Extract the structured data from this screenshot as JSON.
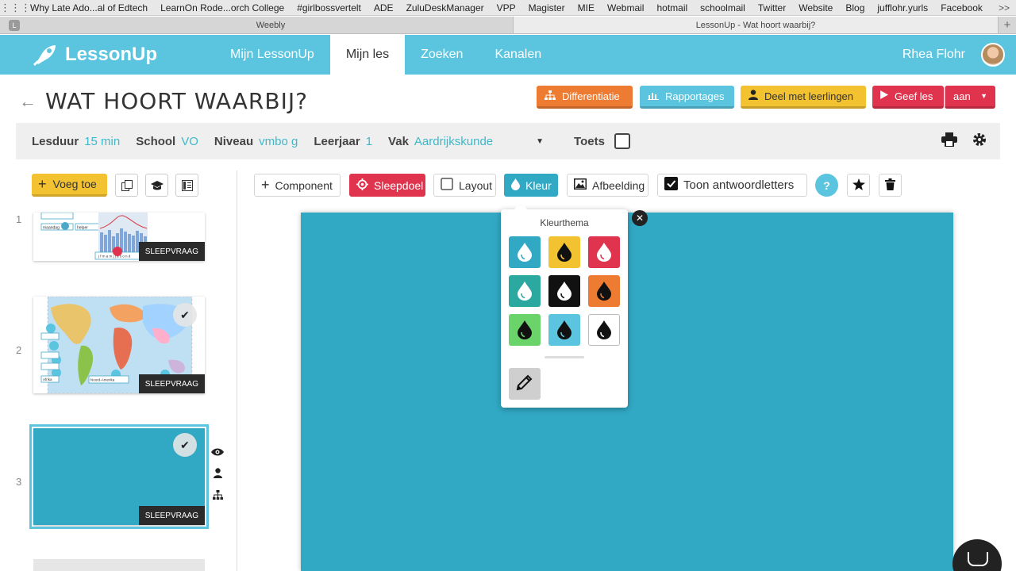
{
  "browser": {
    "bookmarks": [
      "Why Late Ado...al of Edtech",
      "LearnOn Rode...orch College",
      "#girlbossvertelt",
      "ADE",
      "ZuluDeskManager",
      "VPP",
      "Magister",
      "MIE",
      "Webmail",
      "hotmail",
      "schoolmail",
      "Twitter",
      "Website",
      "Blog",
      "jufflohr.yurls",
      "Facebook"
    ],
    "bookmarks_more": ">>",
    "tab_lead": "L",
    "tabs": [
      {
        "label": "Weebly"
      },
      {
        "label": "LessonUp - Wat hoort waarbij?"
      }
    ],
    "new_tab": "+"
  },
  "header": {
    "logo": "LessonUp",
    "nav": [
      "Mijn LessonUp",
      "Mijn les",
      "Zoeken",
      "Kanalen"
    ],
    "active_nav": "Mijn les",
    "user_name": "Rhea Flohr",
    "brand_color": "#5bc4de"
  },
  "title": {
    "back_icon": "←",
    "text": "WAT HOORT WAARBIJ?",
    "buttons": {
      "differentiatie": "Differentiatie",
      "rapportages": "Rapportages",
      "deel": "Deel met leerlingen",
      "geef_les": "Geef les",
      "aan": "aan",
      "aan_caret": "▼"
    }
  },
  "meta": {
    "lesduur_label": "Lesduur",
    "lesduur_value": "15 min",
    "school_label": "School",
    "school_value": "VO",
    "niveau_label": "Niveau",
    "niveau_value": "vmbo g",
    "leerjaar_label": "Leerjaar",
    "leerjaar_value": "1",
    "vak_label": "Vak",
    "vak_value": "Aardrijkskunde",
    "dropdown_caret": "▼",
    "toets_label": "Toets",
    "toets_checked": false
  },
  "sidebar": {
    "add_button": "Voeg toe",
    "add_plus": "+",
    "slides": [
      {
        "number": "1",
        "tag": "SLEEPVRAAG"
      },
      {
        "number": "2",
        "tag": "SLEEPVRAAG"
      },
      {
        "number": "3",
        "tag": "SLEEPVRAAG"
      }
    ],
    "slide1_labels": {
      "a": "maandag",
      "b": "helper",
      "months": "j f m a m j j a s o n d"
    },
    "slide2_labels": {
      "a": "Noord-Amerika",
      "b": "Afrika"
    }
  },
  "editor": {
    "toolbar": {
      "component": "Component",
      "sleepdoel": "Sleepdoel",
      "layout": "Layout",
      "kleur": "Kleur",
      "afbeelding": "Afbeelding",
      "toon": "Toon antwoordletters",
      "help": "?"
    },
    "canvas_color": "#31a9c5"
  },
  "color_popover": {
    "title": "Kleurthema",
    "close": "✕",
    "swatches": [
      {
        "bg": "#31a9c5",
        "drop": "#ffffff"
      },
      {
        "bg": "#f3c231",
        "drop": "#111111"
      },
      {
        "bg": "#e0344e",
        "drop": "#ffffff"
      },
      {
        "bg": "#2ba9a1",
        "drop": "#ffffff"
      },
      {
        "bg": "#111111",
        "drop": "#ffffff"
      },
      {
        "bg": "#ee7b32",
        "drop": "#111111"
      },
      {
        "bg": "#6ad36a",
        "drop": "#111111"
      },
      {
        "bg": "#5bc4de",
        "drop": "#111111"
      },
      {
        "bg": "#ffffff",
        "drop": "#111111"
      }
    ]
  }
}
